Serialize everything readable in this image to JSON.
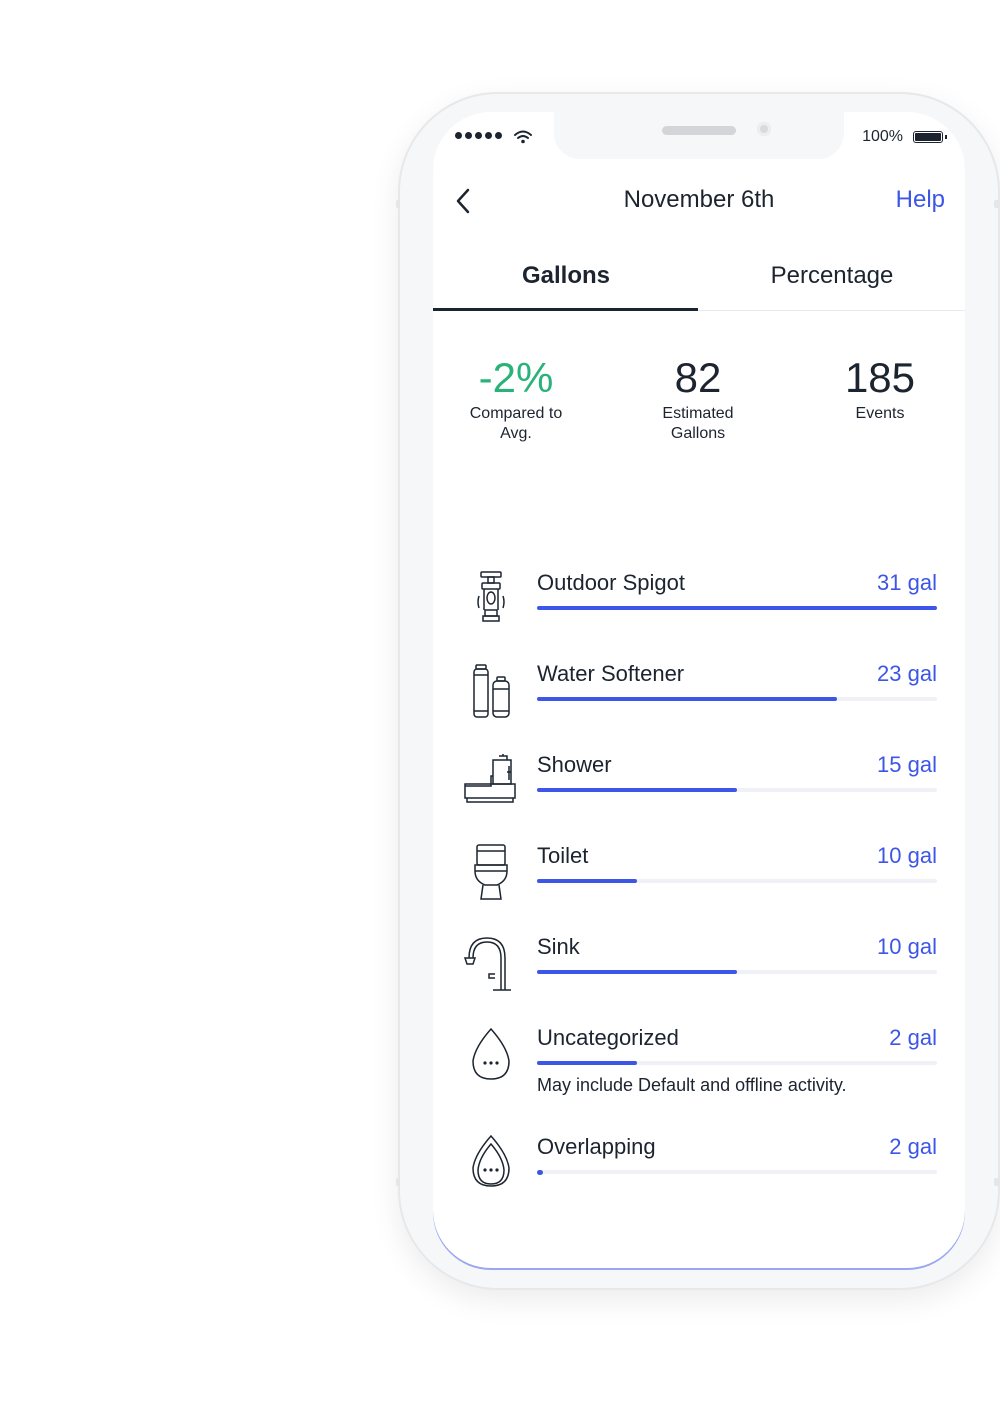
{
  "status_bar": {
    "battery": "100%"
  },
  "header": {
    "title": "November 6th",
    "help": "Help"
  },
  "tabs": [
    {
      "label": "Gallons"
    },
    {
      "label": "Percentage"
    }
  ],
  "stats": [
    {
      "value": "-2%",
      "label": "Compared to Avg.",
      "color": "#2ab27b"
    },
    {
      "value": "82",
      "label": "Estimated Gallons"
    },
    {
      "value": "185",
      "label": "Events"
    }
  ],
  "categories": [
    {
      "name": "Outdoor Spigot",
      "value": "31 gal",
      "fraction": 1.0,
      "icon": "spigot-icon"
    },
    {
      "name": "Water Softener",
      "value": "23 gal",
      "fraction": 0.75,
      "icon": "water-softener-icon"
    },
    {
      "name": "Shower",
      "value": "15 gal",
      "fraction": 0.5,
      "icon": "shower-icon"
    },
    {
      "name": "Toilet",
      "value": "10 gal",
      "fraction": 0.25,
      "icon": "toilet-icon"
    },
    {
      "name": "Sink",
      "value": "10 gal",
      "fraction": 0.5,
      "icon": "sink-icon"
    },
    {
      "name": "Uncategorized",
      "value": "2 gal",
      "fraction": 0.25,
      "note": "May include Default and offline activity.",
      "icon": "uncategorized-drop-icon"
    },
    {
      "name": "Overlapping",
      "value": "2 gal",
      "fraction": 0.01,
      "icon": "overlapping-drop-icon"
    }
  ],
  "colors": {
    "accent": "#3d56e8",
    "positive": "#2ab27b",
    "text": "#1c2430"
  }
}
